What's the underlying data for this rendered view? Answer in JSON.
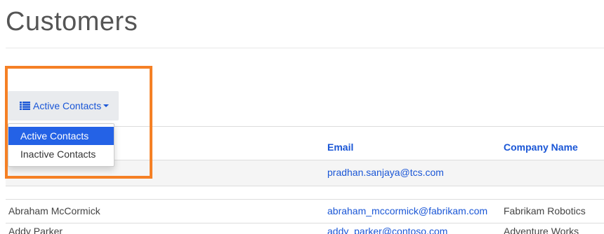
{
  "page": {
    "title": "Customers"
  },
  "view_selector": {
    "label": "Active Contacts",
    "icon": "list-icon",
    "options": [
      {
        "label": "Active Contacts",
        "selected": true
      },
      {
        "label": "Inactive Contacts",
        "selected": false
      }
    ]
  },
  "table": {
    "columns": [
      {
        "key": "name",
        "label": ""
      },
      {
        "key": "email",
        "label": "Email"
      },
      {
        "key": "company",
        "label": "Company Name"
      }
    ],
    "rows": [
      {
        "name": "",
        "email": "pradhan.sanjaya@tcs.com",
        "company": ""
      },
      {
        "name": "Abraham McCormick",
        "email": "abraham_mccormick@fabrikam.com",
        "company": "Fabrikam Robotics"
      },
      {
        "name": "Addy Parker",
        "email": "addy_parker@contoso.com",
        "company": "Adventure Works"
      }
    ]
  },
  "colors": {
    "accent": "#1a56d6",
    "selected_item": "#2462e6",
    "highlight": "#f58025"
  }
}
